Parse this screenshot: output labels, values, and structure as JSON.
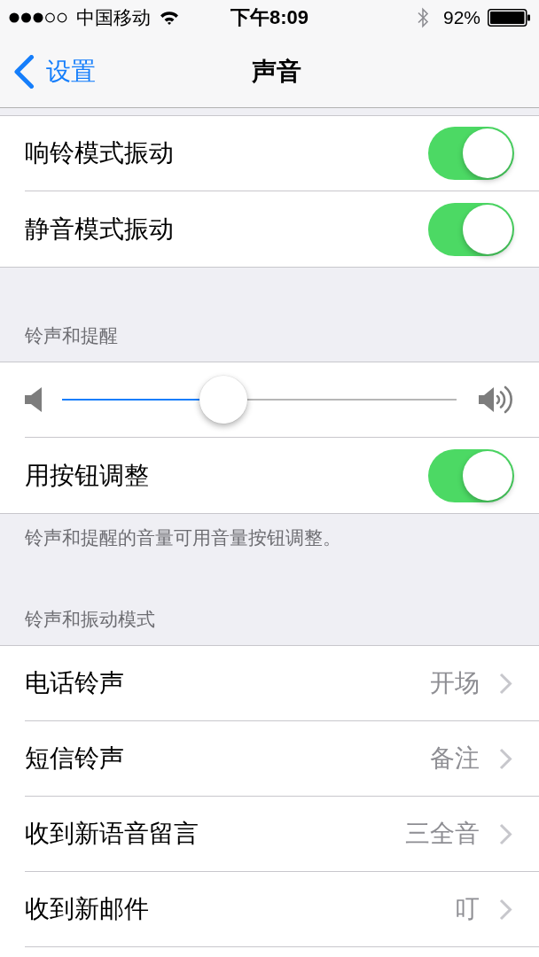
{
  "status_bar": {
    "carrier": "中国移动",
    "time": "下午8:09",
    "battery": "92%"
  },
  "nav": {
    "back": "设置",
    "title": "声音"
  },
  "groups": [
    {
      "rows": [
        {
          "kind": "toggle",
          "label": "响铃模式振动",
          "on": true
        },
        {
          "kind": "toggle",
          "label": "静音模式振动",
          "on": true
        }
      ]
    },
    {
      "header": "铃声和提醒",
      "rows": [
        {
          "kind": "slider",
          "level": 0.41
        },
        {
          "kind": "toggle",
          "label": "用按钮调整",
          "on": true
        }
      ],
      "footer": "铃声和提醒的音量可用音量按钮调整。"
    },
    {
      "header": "铃声和振动模式",
      "rows": [
        {
          "kind": "link",
          "label": "电话铃声",
          "value": "开场"
        },
        {
          "kind": "link",
          "label": "短信铃声",
          "value": "备注"
        },
        {
          "kind": "link",
          "label": "收到新语音留言",
          "value": "三全音"
        },
        {
          "kind": "link",
          "label": "收到新邮件",
          "value": "叮"
        }
      ]
    }
  ]
}
